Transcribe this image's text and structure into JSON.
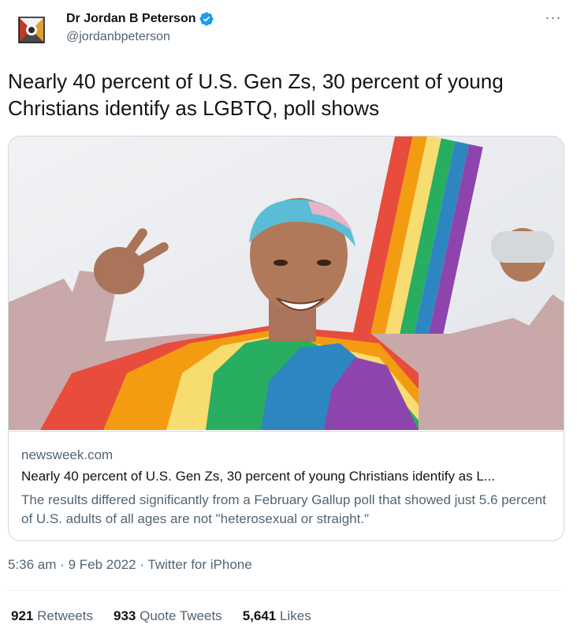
{
  "author": {
    "display_name": "Dr Jordan B Peterson",
    "handle": "@jordanbpeterson",
    "verified_icon": "verified-badge-icon",
    "avatar_icon": "emblem-avatar"
  },
  "menu": {
    "more_label": "···"
  },
  "tweet": {
    "text": "Nearly 40 percent of U.S. Gen Zs, 30 percent of young Christians identify as LGBTQ, poll shows"
  },
  "card": {
    "image_icon": "card-photo",
    "domain": "newsweek.com",
    "title": "Nearly 40 percent of U.S. Gen Zs, 30 percent of young Christians identify as L...",
    "description": "The results differed significantly from a February Gallup poll that showed just 5.6 percent of U.S. adults of all ages are not \"heterosexual or straight.\""
  },
  "meta": {
    "time": "5:36 am",
    "separator": "·",
    "date": "9 Feb 2022",
    "source": "Twitter for iPhone"
  },
  "stats": {
    "retweets_count": "921",
    "retweets_label": "Retweets",
    "quotes_count": "933",
    "quotes_label": "Quote Tweets",
    "likes_count": "5,641",
    "likes_label": "Likes"
  },
  "colors": {
    "text": "#0f1419",
    "secondary": "#536471",
    "border": "#cfd9de",
    "verified": "#1d9bf0"
  }
}
